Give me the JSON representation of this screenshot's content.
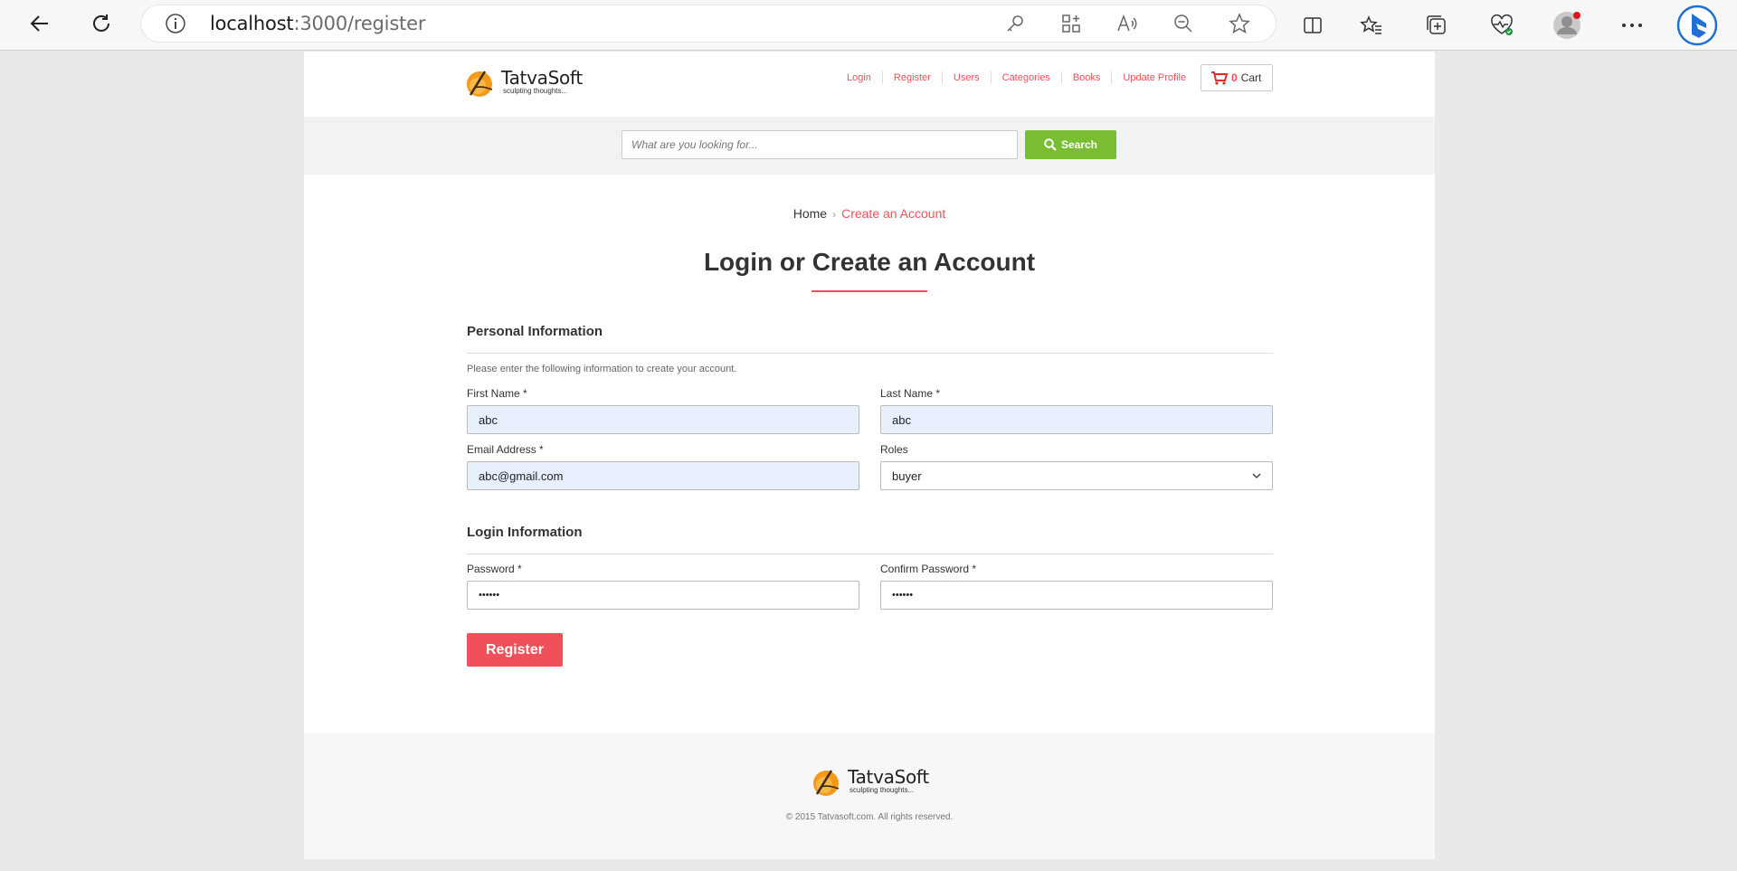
{
  "browser": {
    "url_host": "localhost",
    "url_path": ":3000/register"
  },
  "header": {
    "brand": "TatvaSoft",
    "tagline": "sculpting thoughts...",
    "nav": [
      "Login",
      "Register",
      "Users",
      "Categories",
      "Books",
      "Update Profile"
    ],
    "cart_count": "0",
    "cart_label": "Cart"
  },
  "search": {
    "placeholder": "What are you looking for...",
    "button": "Search"
  },
  "breadcrumb": {
    "home": "Home",
    "separator": "›",
    "current": "Create an Account"
  },
  "page_title": "Login or Create an Account",
  "personal": {
    "title": "Personal Information",
    "help": "Please enter the following information to create your account.",
    "first_name_label": "First Name *",
    "first_name_value": "abc",
    "last_name_label": "Last Name *",
    "last_name_value": "abc",
    "email_label": "Email Address *",
    "email_value": "abc@gmail.com",
    "roles_label": "Roles",
    "roles_value": "buyer"
  },
  "login": {
    "title": "Login Information",
    "password_label": "Password *",
    "password_value": "••••••",
    "confirm_label": "Confirm Password *",
    "confirm_value": "••••••"
  },
  "register_button": "Register",
  "footer": {
    "brand": "TatvaSoft",
    "tagline": "sculpting thoughts...",
    "copyright": "© 2015 Tatvasoft.com. All rights reserved."
  },
  "colors": {
    "accent": "#f0505a",
    "search_green": "#79bd31",
    "autofill": "#e8f0fe"
  }
}
